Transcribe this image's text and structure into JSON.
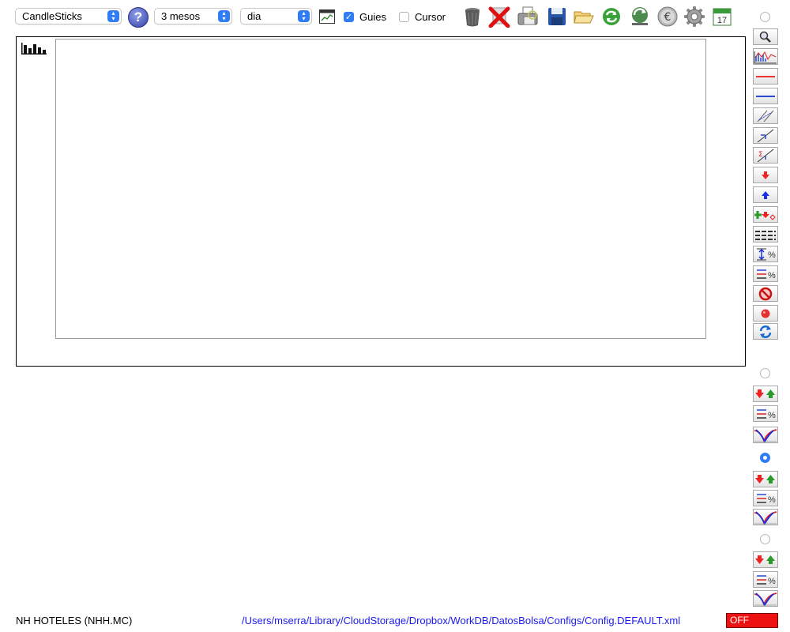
{
  "toolbar": {
    "chart_type": {
      "value": "CandleSticks"
    },
    "period": {
      "value": "3 mesos"
    },
    "interval": {
      "value": "dia"
    },
    "guides": {
      "label": "Guies",
      "checked": true
    },
    "cursor": {
      "label": "Cursor",
      "checked": false
    },
    "calendar_day": "17"
  },
  "status": {
    "ticker": "NH HOTELES (NHH.MC)",
    "config_path": "/Users/mserra/Library/CloudStorage/Dropbox/WorkDB/DatosBolsa/Configs/Config.DEFAULT.xml",
    "toggle_label": "OFF"
  }
}
